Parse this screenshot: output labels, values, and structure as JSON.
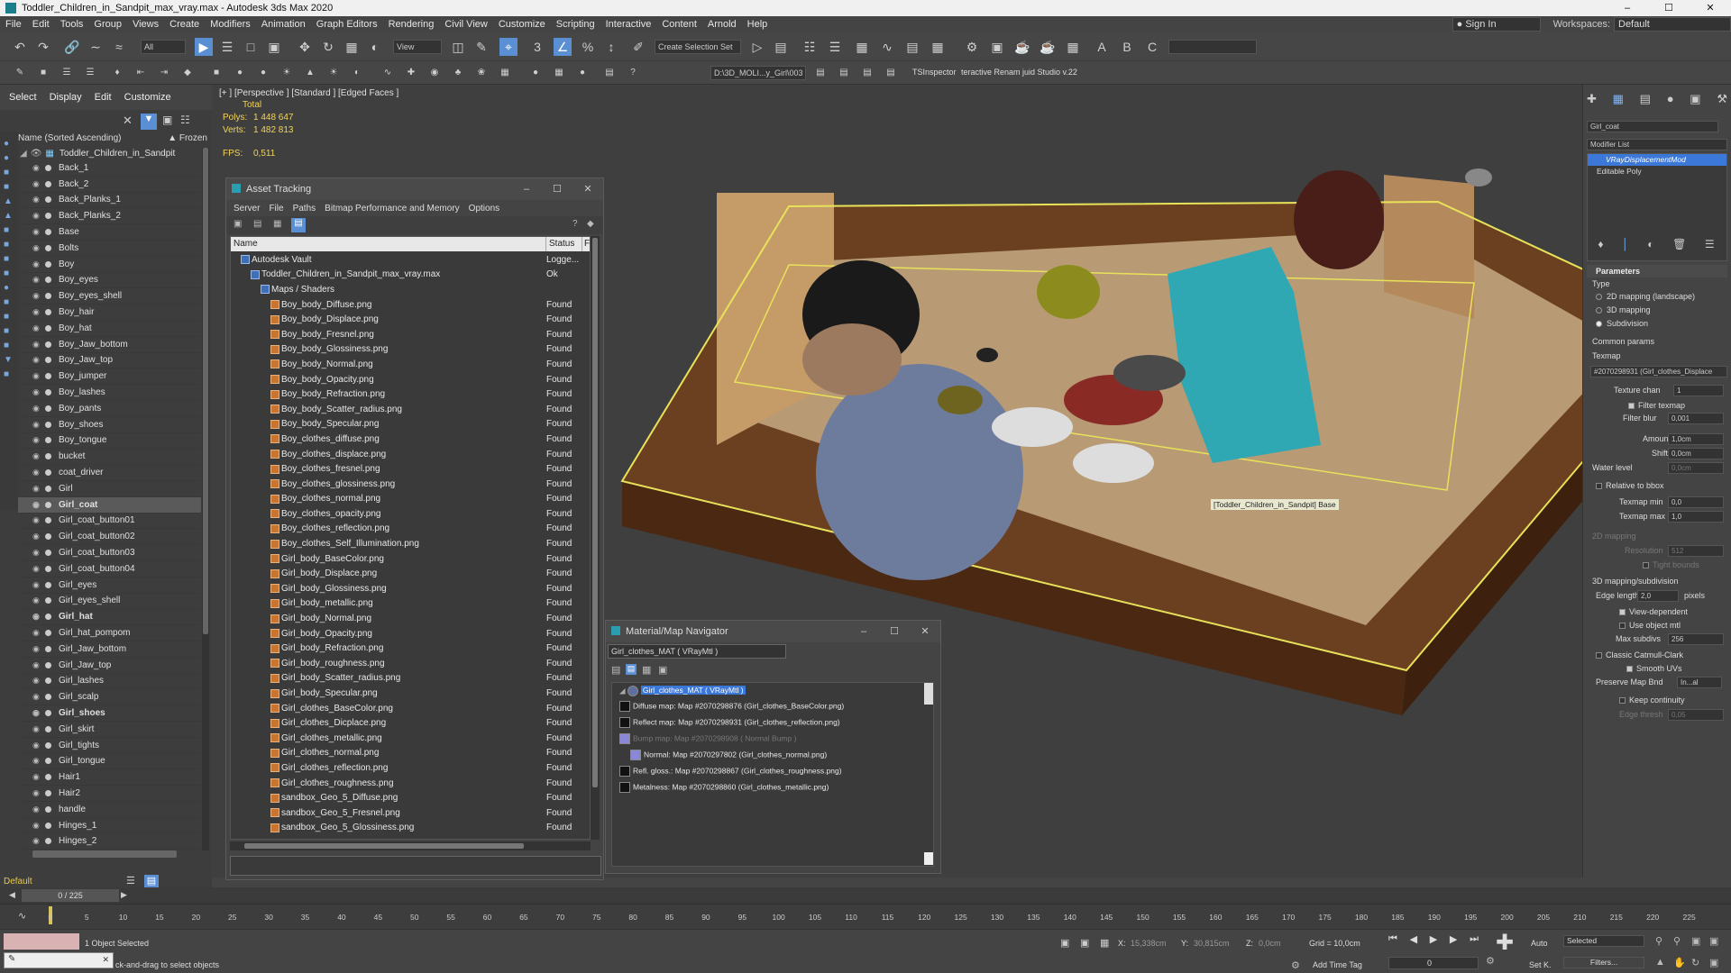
{
  "window": {
    "title": "Toddler_Children_in_Sandpit_max_vray.max - Autodesk 3ds Max 2020",
    "controls": [
      "–",
      "☐",
      "✕"
    ]
  },
  "menu": {
    "items": [
      "File",
      "Edit",
      "Tools",
      "Group",
      "Views",
      "Create",
      "Modifiers",
      "Animation",
      "Graph Editors",
      "Rendering",
      "Civil View",
      "Customize",
      "Scripting",
      "Interactive",
      "Content",
      "Arnold",
      "Help"
    ],
    "signin": "Sign In",
    "workspaces_label": "Workspaces:",
    "workspaces_value": "Default"
  },
  "toolbar": {
    "filter_select": "All",
    "view_select": "View",
    "selection_set": "Create Selection Set",
    "path_field": "D:\\3D_MOLI...y_Girl\\003",
    "ts_inspector": "TSInspector",
    "renamer": "teractive Renam juid Studio v.22"
  },
  "scene_explorer": {
    "tabs": [
      "Select",
      "Display",
      "Edit",
      "Customize"
    ],
    "col_name": "Name (Sorted Ascending)",
    "col_frozen": "▲ Frozen",
    "root": "Toddler_Children_in_Sandpit",
    "items": [
      "Back_1",
      "Back_2",
      "Back_Planks_1",
      "Back_Planks_2",
      "Base",
      "Bolts",
      "Boy",
      "Boy_eyes",
      "Boy_eyes_shell",
      "Boy_hair",
      "Boy_hat",
      "Boy_Jaw_bottom",
      "Boy_Jaw_top",
      "Boy_jumper",
      "Boy_lashes",
      "Boy_pants",
      "Boy_shoes",
      "Boy_tongue",
      "bucket",
      "coat_driver",
      "Girl",
      "Girl_coat",
      "Girl_coat_button01",
      "Girl_coat_button02",
      "Girl_coat_button03",
      "Girl_coat_button04",
      "Girl_eyes",
      "Girl_eyes_shell",
      "Girl_hat",
      "Girl_hat_pompom",
      "Girl_Jaw_bottom",
      "Girl_Jaw_top",
      "Girl_lashes",
      "Girl_scalp",
      "Girl_shoes",
      "Girl_skirt",
      "Girl_tights",
      "Girl_tongue",
      "Hair1",
      "Hair2",
      "handle",
      "Hinges_1",
      "Hinges_2"
    ],
    "selected_index": 21,
    "bold_indices": [
      21,
      28,
      34
    ],
    "layer_label": "Default"
  },
  "viewport": {
    "label": "[+ ] [Perspective ] [Standard ] [Edged Faces ]",
    "total_label": "Total",
    "polys_label": "Polys:",
    "polys_value": "1 448 647",
    "verts_label": "Verts:",
    "verts_value": "1 482 813",
    "fps_label": "FPS:",
    "fps_value": "0,511",
    "tooltip": "[Toddler_Children_in_Sandpit] Base"
  },
  "asset_tracking": {
    "title": "Asset Tracking",
    "menu": [
      "Server",
      "File",
      "Paths",
      "Bitmap Performance and Memory",
      "Options"
    ],
    "col_name": "Name",
    "col_status": "Status",
    "col_extra": "F",
    "rows": [
      {
        "name": "Autodesk Vault",
        "status": "Logge...",
        "level": 1
      },
      {
        "name": "Toddler_Children_in_Sandpit_max_vray.max",
        "status": "Ok",
        "level": 2
      },
      {
        "name": "Maps / Shaders",
        "status": "",
        "level": 3
      },
      {
        "name": "Boy_body_Diffuse.png",
        "status": "Found",
        "level": 4
      },
      {
        "name": "Boy_body_Displace.png",
        "status": "Found",
        "level": 4
      },
      {
        "name": "Boy_body_Fresnel.png",
        "status": "Found",
        "level": 4
      },
      {
        "name": "Boy_body_Glossiness.png",
        "status": "Found",
        "level": 4
      },
      {
        "name": "Boy_body_Normal.png",
        "status": "Found",
        "level": 4
      },
      {
        "name": "Boy_body_Opacity.png",
        "status": "Found",
        "level": 4
      },
      {
        "name": "Boy_body_Refraction.png",
        "status": "Found",
        "level": 4
      },
      {
        "name": "Boy_body_Scatter_radius.png",
        "status": "Found",
        "level": 4
      },
      {
        "name": "Boy_body_Specular.png",
        "status": "Found",
        "level": 4
      },
      {
        "name": "Boy_clothes_diffuse.png",
        "status": "Found",
        "level": 4
      },
      {
        "name": "Boy_clothes_displace.png",
        "status": "Found",
        "level": 4
      },
      {
        "name": "Boy_clothes_fresnel.png",
        "status": "Found",
        "level": 4
      },
      {
        "name": "Boy_clothes_glossiness.png",
        "status": "Found",
        "level": 4
      },
      {
        "name": "Boy_clothes_normal.png",
        "status": "Found",
        "level": 4
      },
      {
        "name": "Boy_clothes_opacity.png",
        "status": "Found",
        "level": 4
      },
      {
        "name": "Boy_clothes_reflection.png",
        "status": "Found",
        "level": 4
      },
      {
        "name": "Boy_clothes_Self_Illumination.png",
        "status": "Found",
        "level": 4
      },
      {
        "name": "Girl_body_BaseColor.png",
        "status": "Found",
        "level": 4
      },
      {
        "name": "Girl_body_Displace.png",
        "status": "Found",
        "level": 4
      },
      {
        "name": "Girl_body_Glossiness.png",
        "status": "Found",
        "level": 4
      },
      {
        "name": "Girl_body_metallic.png",
        "status": "Found",
        "level": 4
      },
      {
        "name": "Girl_body_Normal.png",
        "status": "Found",
        "level": 4
      },
      {
        "name": "Girl_body_Opacity.png",
        "status": "Found",
        "level": 4
      },
      {
        "name": "Girl_body_Refraction.png",
        "status": "Found",
        "level": 4
      },
      {
        "name": "Girl_body_roughness.png",
        "status": "Found",
        "level": 4
      },
      {
        "name": "Girl_body_Scatter_radius.png",
        "status": "Found",
        "level": 4
      },
      {
        "name": "Girl_body_Specular.png",
        "status": "Found",
        "level": 4
      },
      {
        "name": "Girl_clothes_BaseColor.png",
        "status": "Found",
        "level": 4
      },
      {
        "name": "Girl_clothes_Dicplace.png",
        "status": "Found",
        "level": 4
      },
      {
        "name": "Girl_clothes_metallic.png",
        "status": "Found",
        "level": 4
      },
      {
        "name": "Girl_clothes_normal.png",
        "status": "Found",
        "level": 4
      },
      {
        "name": "Girl_clothes_reflection.png",
        "status": "Found",
        "level": 4
      },
      {
        "name": "Girl_clothes_roughness.png",
        "status": "Found",
        "level": 4
      },
      {
        "name": "sandbox_Geo_5_Diffuse.png",
        "status": "Found",
        "level": 4
      },
      {
        "name": "sandbox_Geo_5_Fresnel.png",
        "status": "Found",
        "level": 4
      },
      {
        "name": "sandbox_Geo_5_Glossiness.png",
        "status": "Found",
        "level": 4
      }
    ]
  },
  "material_navigator": {
    "title": "Material/Map Navigator",
    "field": "Girl_clothes_MAT  ( VRayMtl )",
    "root": "Girl_clothes_MAT  ( VRayMtl )",
    "maps": [
      "Diffuse map: Map #2070298876 (Girl_clothes_BaseColor.png)",
      "Reflect map: Map #2070298931 (Girl_clothes_reflection.png)",
      "Bump map: Map #2070298908  ( Normal Bump )",
      "Normal: Map #2070297802 (Girl_clothes_normal.png)",
      "Refl. gloss.: Map #2070298867 (Girl_clothes_roughness.png)",
      "Metalness: Map #2070298860 (Girl_clothes_metallic.png)"
    ]
  },
  "command_panel": {
    "object_name": "Girl_coat",
    "modifier_list": "Modifier List",
    "modifiers": [
      "VRayDisplacementMod",
      "Editable Poly"
    ],
    "parameters": "Parameters",
    "type_label": "Type",
    "type_options": [
      "2D mapping (landscape)",
      "3D mapping",
      "Subdivision"
    ],
    "common_params": "Common params",
    "texmap_label": "Texmap",
    "texmap_value": "#2070298931 (Girl_clothes_Displace",
    "texture_chan_label": "Texture chan",
    "texture_chan_value": "1",
    "filter_texmap": "Filter texmap",
    "filter_blur_label": "Filter blur",
    "filter_blur_value": "0,001",
    "amount_label": "Amount",
    "amount_value": "1,0cm",
    "shift_label": "Shift",
    "shift_value": "0,0cm",
    "water_level_label": "Water level",
    "water_level_value": "0,0cm",
    "relative_to_bbox": "Relative to bbox",
    "texmap_min_label": "Texmap min",
    "texmap_min_value": "0,0",
    "texmap_max_label": "Texmap max",
    "texmap_max_value": "1,0",
    "mapping2d": "2D mapping",
    "resolution_label": "Resolution",
    "resolution_value": "512",
    "tight_bounds": "Tight bounds",
    "mapping3d": "3D mapping/subdivision",
    "edge_length_label": "Edge length",
    "edge_length_value": "2,0",
    "pixels": "pixels",
    "view_dependent": "View-dependent",
    "use_object_mtl": "Use object mtl",
    "max_subdivs_label": "Max subdivs",
    "max_subdivs_value": "256",
    "classic_catmull": "Classic Catmull-Clark",
    "smooth_uvs": "Smooth UVs",
    "preserve_map_bnd_label": "Preserve Map Bnd",
    "preserve_map_bnd_value": "In...al",
    "keep_continuity": "Keep continuity",
    "edge_thresh_label": "Edge thresh",
    "edge_thresh_value": "0,05"
  },
  "timeline": {
    "frame_counter": "0 / 225",
    "ticks": [
      "0",
      "5",
      "10",
      "15",
      "20",
      "25",
      "30",
      "35",
      "40",
      "45",
      "50",
      "55",
      "60",
      "65",
      "70",
      "75",
      "80",
      "85",
      "90",
      "95",
      "100",
      "105",
      "110",
      "115",
      "120",
      "125",
      "130",
      "135",
      "140",
      "145",
      "150",
      "155",
      "160",
      "165",
      "170",
      "175",
      "180",
      "185",
      "190",
      "195",
      "200",
      "205",
      "210",
      "215",
      "220",
      "225"
    ]
  },
  "status": {
    "selected": "1 Object Selected",
    "hint": "ck-and-drag to select objects",
    "x_label": "X:",
    "x_value": "15,338cm",
    "y_label": "Y:",
    "y_value": "30,815cm",
    "z_label": "Z:",
    "z_value": "0,0cm",
    "grid": "Grid = 10,0cm",
    "add_time_tag": "Add Time Tag",
    "auto": "Auto",
    "set_k": "Set K.",
    "selected_dropdown": "Selected",
    "filters": "Filters...",
    "frame_value": "0"
  }
}
